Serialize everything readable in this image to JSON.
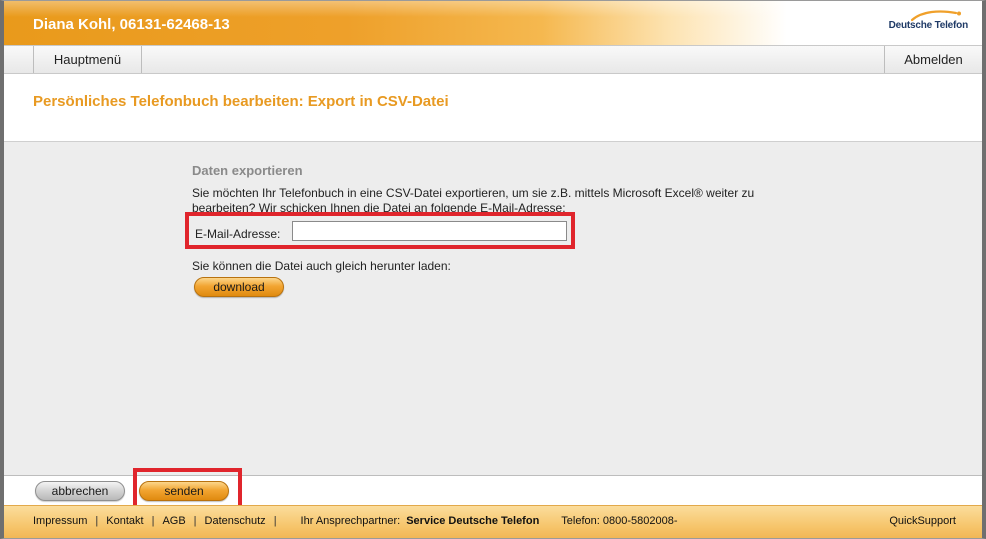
{
  "header": {
    "user_title": "Diana Kohl, 06131-62468-13",
    "brand": "Deutsche Telefon"
  },
  "nav": {
    "main_menu": "Hauptmenü",
    "logout": "Abmelden"
  },
  "page": {
    "title": "Persönliches Telefonbuch bearbeiten: Export in CSV-Datei"
  },
  "export": {
    "heading": "Daten exportieren",
    "intro": "Sie möchten Ihr Telefonbuch in eine CSV-Datei exportieren, um sie z.B. mittels Microsoft Excel® weiter zu bearbeiten? Wir schicken Ihnen die Datei an folgende E-Mail-Adresse:",
    "email_label": "E-Mail-Adresse:",
    "email_value": "",
    "download_text": "Sie können die Datei auch gleich herunter laden:",
    "download_button": "download"
  },
  "actions": {
    "cancel": "abbrechen",
    "send": "senden"
  },
  "footer": {
    "links": [
      "Impressum",
      "Kontakt",
      "AGB",
      "Datenschutz"
    ],
    "contact_label": "Ihr Ansprechpartner:",
    "contact_name": "Service Deutsche Telefon",
    "phone": "Telefon: 0800-5802008-",
    "quicksupport": "QuickSupport"
  },
  "colors": {
    "accent_orange": "#e89a22",
    "highlight_red": "#e0252c",
    "brand_blue": "#1f3a66"
  }
}
